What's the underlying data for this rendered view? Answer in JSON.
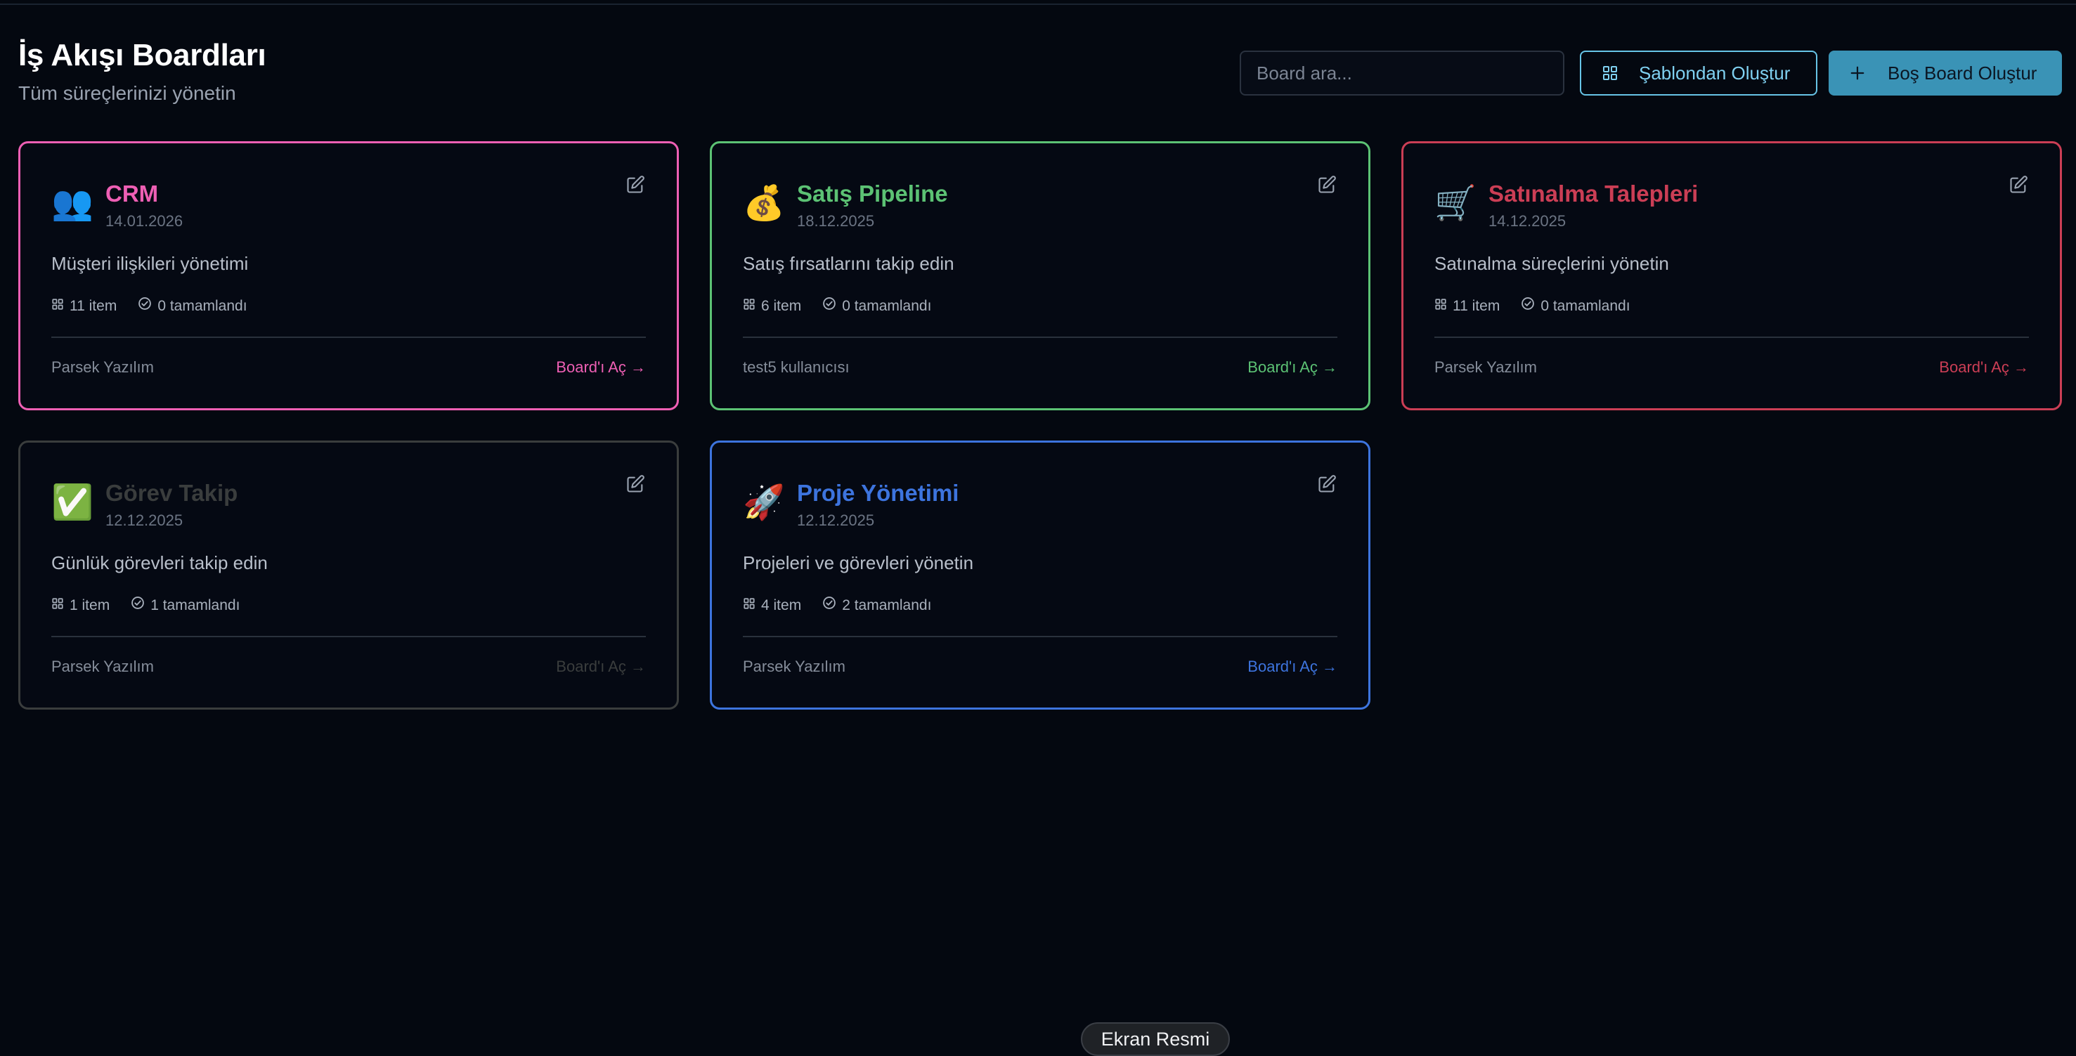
{
  "header": {
    "title": "İş Akışı Boardları",
    "subtitle": "Tüm süreçlerinizi yönetin"
  },
  "toolbar": {
    "search_placeholder": "Board ara...",
    "template_button": "Şablondan Oluştur",
    "blank_button": "Boş Board Oluştur",
    "template_icon": "grid-icon",
    "blank_icon": "plus-icon"
  },
  "boards": [
    {
      "name": "CRM",
      "emoji": "👥",
      "date": "14.01.2026",
      "description": "Müşteri ilişkileri yönetimi",
      "items": "11 item",
      "completed": "0 tamamlandı",
      "owner": "Parsek Yazılım",
      "open_label": "Board'ı Aç →",
      "color": "#ee5fb4"
    },
    {
      "name": "Satış Pipeline",
      "emoji": "💰",
      "date": "18.12.2025",
      "description": "Satış fırsatlarını takip edin",
      "items": "6 item",
      "completed": "0 tamamlandı",
      "owner": "test5 kullanıcısı",
      "open_label": "Board'ı Aç →",
      "color": "#5cc274"
    },
    {
      "name": "Satınalma Talepleri",
      "emoji": "🛒",
      "date": "14.12.2025",
      "description": "Satınalma süreçlerini yönetin",
      "items": "11 item",
      "completed": "0 tamamlandı",
      "owner": "Parsek Yazılım",
      "open_label": "Board'ı Aç →",
      "color": "#cb3e55"
    },
    {
      "name": "Görev Takip",
      "emoji": "✅",
      "date": "12.12.2025",
      "description": "Günlük görevleri takip edin",
      "items": "1 item",
      "completed": "1 tamamlandı",
      "owner": "Parsek Yazılım",
      "open_label": "Board'ı Aç →",
      "color": "#3a3d3d"
    },
    {
      "name": "Proje Yönetimi",
      "emoji": "🚀",
      "date": "12.12.2025",
      "description": "Projeleri ve görevleri yönetin",
      "items": "4 item",
      "completed": "2 tamamlandı",
      "owner": "Parsek Yazılım",
      "open_label": "Board'ı Aç →",
      "color": "#3d74de"
    }
  ],
  "overlay": {
    "screenshot_label": "Ekran Resmi"
  }
}
